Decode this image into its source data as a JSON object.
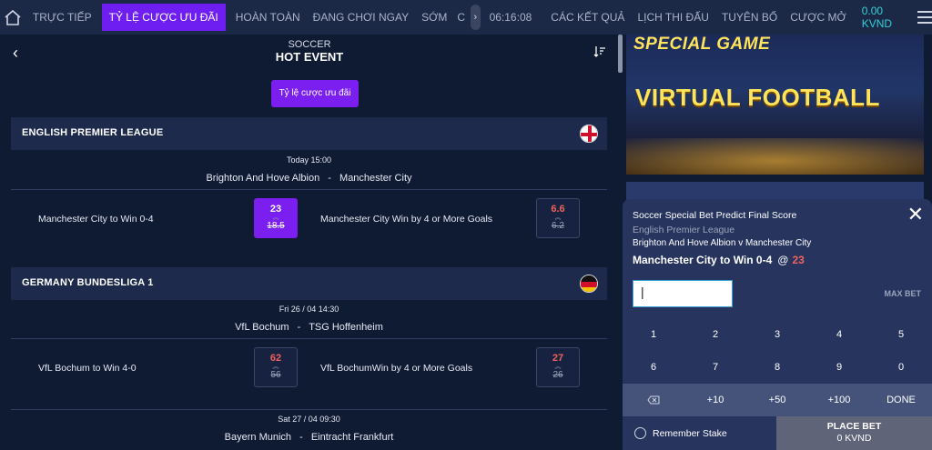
{
  "nav": {
    "items": [
      "TRỰC TIẾP",
      "TỶ LỆ CƯỢC ƯU ĐÃI",
      "HOÀN TOÀN",
      "ĐANG CHƠI NGAY",
      "SỚM",
      "C"
    ],
    "time": "06:16:08",
    "items_right": [
      "CÁC KẾT QUẢ",
      "LỊCH THI ĐẤU",
      "TUYÊN BỐ",
      "CƯỢC MỞ"
    ],
    "balance": "0.00 KVND",
    "active_index": 1
  },
  "header": {
    "sport": "SOCCER",
    "title": "HOT EVENT"
  },
  "promo_button": "Tỷ lệ cược ưu đãi",
  "leagues": [
    {
      "name": "ENGLISH PREMIER LEAGUE",
      "event": {
        "time": "Today 15:00",
        "home": "Brighton And Hove Albion",
        "away": "Manchester City",
        "sep": "-",
        "bets": [
          {
            "label": "Manchester City to Win 0-4",
            "odds": "23",
            "old": "18.5",
            "selected": true
          },
          {
            "label": "Manchester City Win by 4 or More Goals",
            "odds": "6.6",
            "old": "6.2",
            "selected": false
          }
        ]
      }
    },
    {
      "name": "GERMANY BUNDESLIGA 1",
      "event": {
        "time": "Fri 26 / 04 14:30",
        "home": "VfL Bochum",
        "away": "TSG Hoffenheim",
        "sep": "-",
        "bets": [
          {
            "label": "VfL Bochum to Win 4-0",
            "odds": "62",
            "old": "56",
            "selected": false
          },
          {
            "label": "VfL BochumWin by 4 or More Goals",
            "odds": "27",
            "old": "26",
            "selected": false
          }
        ]
      }
    }
  ],
  "next_event": {
    "time": "Sat 27 / 04 09:30",
    "home": "Bayern Munich",
    "away": "Eintracht Frankfurt",
    "sep": "-"
  },
  "banner": {
    "line1": "SPECIAL GAME",
    "line2": "VIRTUAL FOOTBALL"
  },
  "slip": {
    "title": "Soccer Special Bet Predict Final Score",
    "league": "English Premier League",
    "match": "Brighton And Hove Albion v Manchester City",
    "pick": "Manchester City to Win 0-4",
    "at": "@",
    "odds": "23",
    "stake_value": "|",
    "max_bet": "MAX BET",
    "keys_row1": [
      "1",
      "2",
      "3",
      "4",
      "5"
    ],
    "keys_row2": [
      "6",
      "7",
      "8",
      "9",
      "0"
    ],
    "keys_row3": [
      "",
      "+10",
      "+50",
      "+100",
      "DONE"
    ],
    "remember": "Remember Stake",
    "place_bet": "PLACE BET",
    "place_amount": "0 KVND"
  },
  "colors": {
    "accent": "#7a1ff0",
    "odds_red": "#f0625a",
    "balance": "#2fd2d8"
  }
}
